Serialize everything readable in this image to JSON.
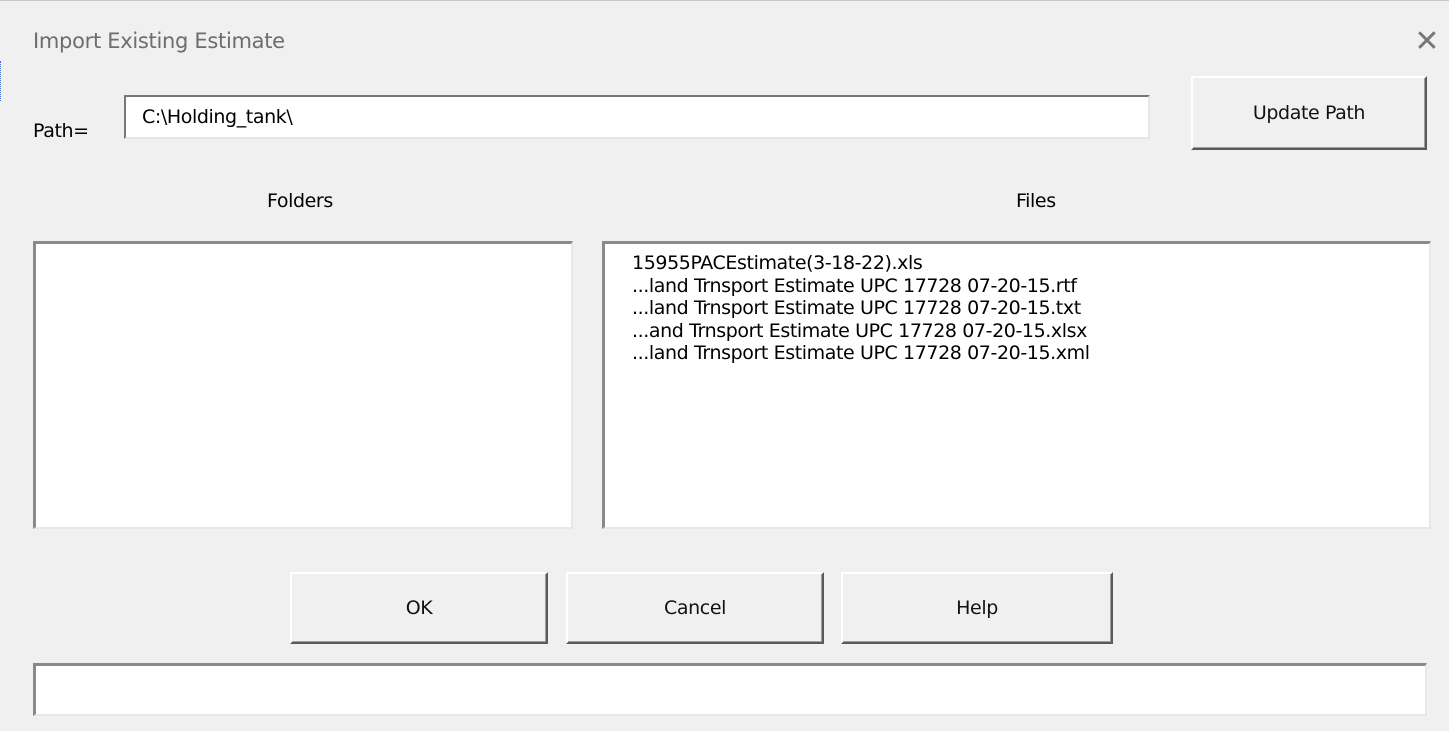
{
  "dialog": {
    "title": "Import Existing Estimate",
    "close_glyph": "✕"
  },
  "path": {
    "label": "Path=",
    "value": "C:\\Holding_tank\\",
    "update_button": "Update Path"
  },
  "folders": {
    "label": "Folders",
    "items": []
  },
  "files": {
    "label": "Files",
    "items": [
      "15955PACEstimate(3-18-22).xls",
      "...land Trnsport Estimate UPC 17728 07-20-15.rtf",
      "...land Trnsport Estimate UPC 17728 07-20-15.txt",
      "...and Trnsport Estimate UPC 17728 07-20-15.xlsx",
      "...land Trnsport Estimate UPC 17728 07-20-15.xml"
    ]
  },
  "buttons": {
    "ok": "OK",
    "cancel": "Cancel",
    "help": "Help"
  },
  "status": {
    "value": ""
  },
  "icons": {
    "close": "close-icon"
  }
}
